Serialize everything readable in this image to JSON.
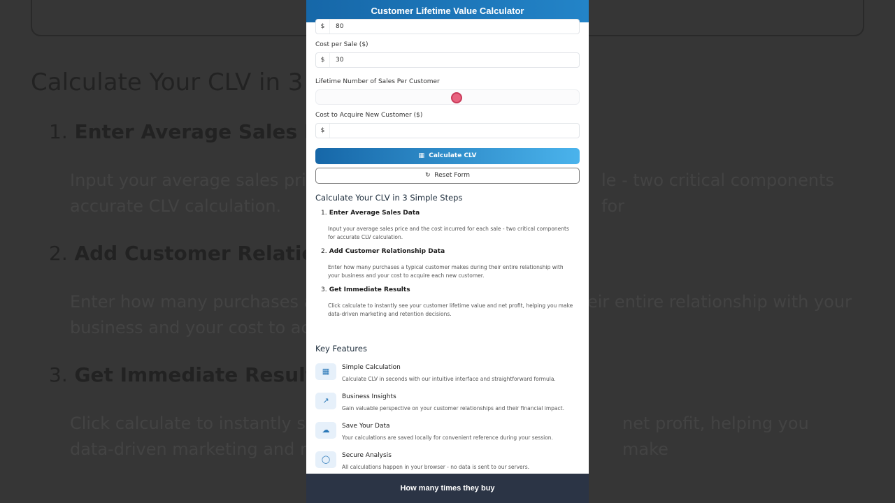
{
  "background": {
    "heading": "Calculate Your CLV in 3",
    "step1": {
      "num": "1.",
      "title": "Enter Average Sales Dat"
    },
    "step1_text_left": "Input your average sales pric",
    "step1_text_right": "le - two critical components for",
    "step1_text_line2": "accurate CLV calculation.",
    "step2": {
      "num": "2.",
      "title": "Add Customer Relations"
    },
    "step2_text_left": "Enter how many purchases a",
    "step2_text_right": "eir entire relationship with your",
    "step2_text_line2": "business and your cost to acc",
    "step3": {
      "num": "3.",
      "title": "Get Immediate Results"
    },
    "step3_text_left": "Click calculate to instantly see",
    "step3_text_right": "net profit, helping you make",
    "step3_text_line2": "data-driven marketing and re"
  },
  "app": {
    "title": "Customer Lifetime Value Calculator",
    "fields": {
      "avg_price": {
        "prefix": "$",
        "value": "80"
      },
      "cost_per_sale": {
        "label": "Cost per Sale ($)",
        "prefix": "$",
        "value": "30"
      },
      "lifetime_sales": {
        "label": "Lifetime Number of Sales Per Customer"
      },
      "acquire_cost": {
        "label": "Cost to Acquire New Customer ($)",
        "prefix": "$",
        "value": ""
      }
    },
    "buttons": {
      "calculate": "Calculate CLV",
      "reset": "Reset Form"
    },
    "steps_title": "Calculate Your CLV in 3 Simple Steps",
    "steps": [
      {
        "num": "1.",
        "title": "Enter Average Sales Data",
        "text": "Input your average sales price and the cost incurred for each sale - two critical components for accurate CLV calculation."
      },
      {
        "num": "2.",
        "title": "Add Customer Relationship Data",
        "text": "Enter how many purchases a typical customer makes during their entire relationship with your business and your cost to acquire each new customer."
      },
      {
        "num": "3.",
        "title": "Get Immediate Results",
        "text": "Click calculate to instantly see your customer lifetime value and net profit, helping you make data-driven marketing and retention decisions."
      }
    ],
    "features_title": "Key Features",
    "features": [
      {
        "icon": "calculator-icon",
        "title": "Simple Calculation",
        "text": "Calculate CLV in seconds with our intuitive interface and straightforward formula."
      },
      {
        "icon": "chart-icon",
        "title": "Business Insights",
        "text": "Gain valuable perspective on your customer relationships and their financial impact."
      },
      {
        "icon": "cloud-icon",
        "title": "Save Your Data",
        "text": "Your calculations are saved locally for convenient reference during your session."
      },
      {
        "icon": "shield-icon",
        "title": "Secure Analysis",
        "text": "All calculations happen in your browser - no data is sent to our servers."
      }
    ],
    "caption": "How many times they buy"
  }
}
